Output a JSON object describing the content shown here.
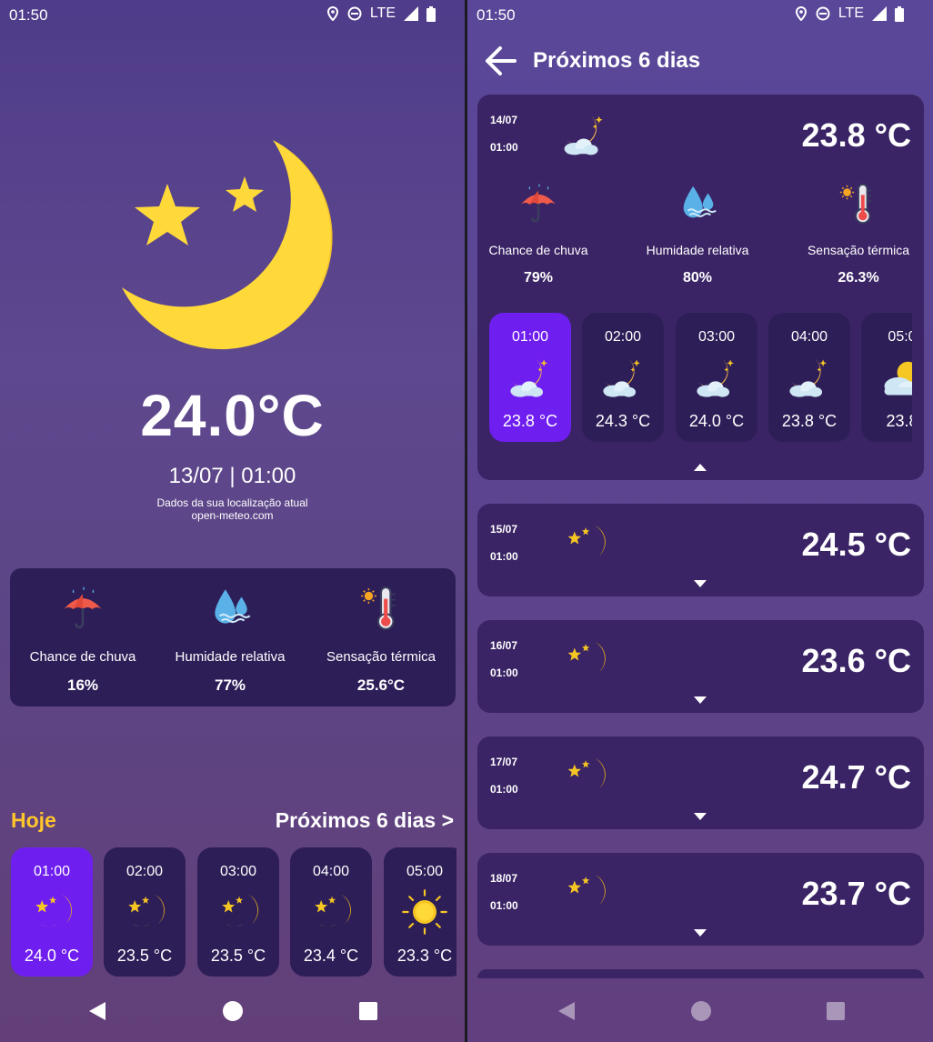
{
  "status": {
    "time": "01:50",
    "network": "LTE"
  },
  "left": {
    "temperature": "24.0°C",
    "datetime": "13/07 | 01:00",
    "location_note": "Dados da sua localização atual",
    "source": "open-meteo.com",
    "metrics": [
      {
        "label": "Chance de chuva",
        "value": "16%",
        "icon": "umbrella-rain-icon"
      },
      {
        "label": "Humidade relativa",
        "value": "77%",
        "icon": "water-drops-icon"
      },
      {
        "label": "Sensação térmica",
        "value": "25.6°C",
        "icon": "thermometer-sun-icon"
      }
    ],
    "today_label": "Hoje",
    "next_days_link": "Próximos 6 dias >",
    "hours": [
      {
        "time": "01:00",
        "temp": "24.0 °C",
        "icon": "moon-stars-icon",
        "selected": true
      },
      {
        "time": "02:00",
        "temp": "23.5 °C",
        "icon": "moon-stars-icon"
      },
      {
        "time": "03:00",
        "temp": "23.5 °C",
        "icon": "moon-stars-icon"
      },
      {
        "time": "04:00",
        "temp": "23.4 °C",
        "icon": "moon-stars-icon"
      },
      {
        "time": "05:00",
        "temp": "23.3 °C",
        "icon": "sun-icon"
      }
    ]
  },
  "right": {
    "title": "Próximos 6 dias",
    "expanded_day": {
      "date": "14/07",
      "time": "01:00",
      "temp": "23.8 °C",
      "icon": "moon-cloud-icon",
      "metrics": [
        {
          "label": "Chance de chuva",
          "value": "79%"
        },
        {
          "label": "Humidade relativa",
          "value": "80%"
        },
        {
          "label": "Sensação térmica",
          "value": "26.3%"
        }
      ],
      "hours": [
        {
          "time": "01:00",
          "temp": "23.8 °C",
          "icon": "moon-cloud-icon",
          "selected": true
        },
        {
          "time": "02:00",
          "temp": "24.3 °C",
          "icon": "moon-cloud-icon"
        },
        {
          "time": "03:00",
          "temp": "24.0 °C",
          "icon": "moon-cloud-icon"
        },
        {
          "time": "04:00",
          "temp": "23.8 °C",
          "icon": "moon-cloud-icon"
        },
        {
          "time": "05:0",
          "temp": "23.8",
          "icon": "sun-cloud-icon"
        }
      ]
    },
    "days": [
      {
        "date": "15/07",
        "time": "01:00",
        "temp": "24.5 °C"
      },
      {
        "date": "16/07",
        "time": "01:00",
        "temp": "23.6 °C"
      },
      {
        "date": "17/07",
        "time": "01:00",
        "temp": "24.7 °C"
      },
      {
        "date": "18/07",
        "time": "01:00",
        "temp": "23.7 °C"
      }
    ]
  },
  "colors": {
    "card": "#2e1e58",
    "selected": "#6f1ef0",
    "accent": "#ffc62b"
  }
}
